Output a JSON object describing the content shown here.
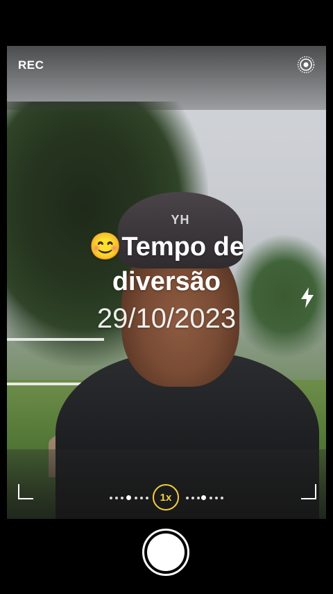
{
  "status": {
    "rec_label": "REC"
  },
  "overlay": {
    "emoji": "😊",
    "title_line1": "Tempo de",
    "title_line2": "diversão",
    "date": "29/10/2023"
  },
  "scene": {
    "beanie_text": "YH"
  },
  "zoom": {
    "label": "1x"
  },
  "icons": {
    "settings": "live-photo-icon",
    "flash": "flash-icon",
    "shutter": "shutter-button"
  },
  "colors": {
    "zoom_accent": "#f4d03f"
  }
}
